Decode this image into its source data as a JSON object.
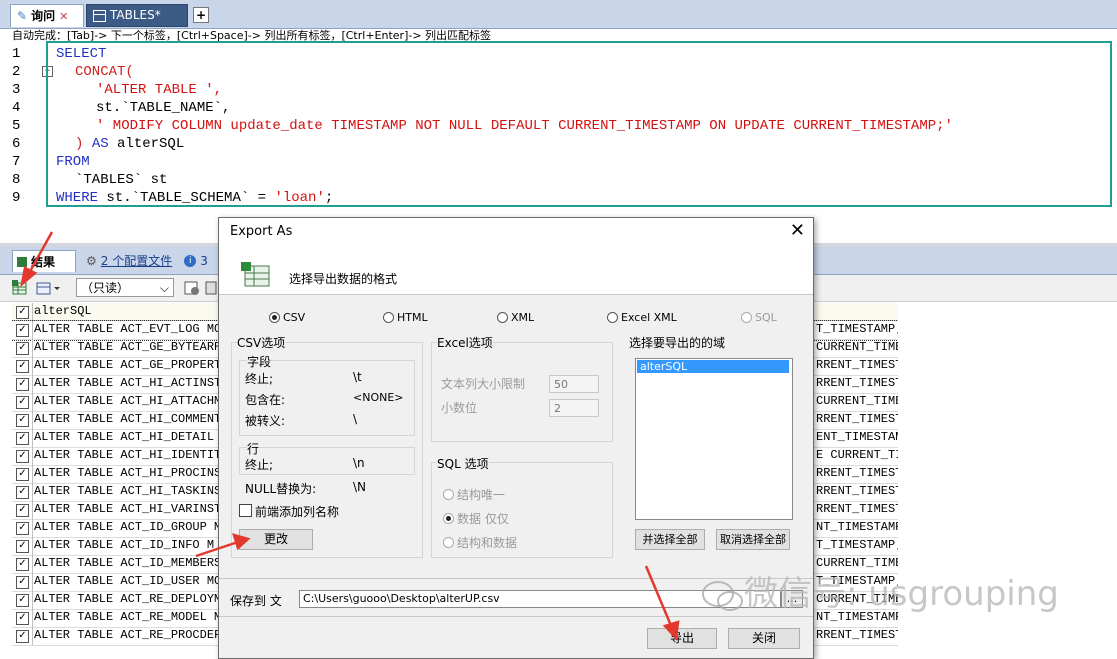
{
  "tabs": [
    {
      "label": "询问",
      "active": true
    },
    {
      "label": "TABLES*",
      "active": false
    }
  ],
  "hint": "自动完成：[Tab]-> 下一个标签，[Ctrl+Space]-> 列出所有标签，[Ctrl+Enter]-> 列出匹配标签",
  "editor": {
    "line_numbers": [
      "1",
      "2",
      "3",
      "4",
      "5",
      "6",
      "7",
      "8",
      "9"
    ],
    "lines": [
      {
        "k1": "SELECT"
      },
      {
        "k1": "CONCAT",
        "t1": "("
      },
      {
        "s1": "'ALTER TABLE ',"
      },
      {
        "t1": "st.`TABLE_NAME`,"
      },
      {
        "s1": "' MODIFY COLUMN update_date TIMESTAMP NOT NULL DEFAULT CURRENT_TIMESTAMP ON UPDATE CURRENT_TIMESTAMP;'"
      },
      {
        "t0": ") ",
        "k1": "AS",
        "t1": " alterSQL"
      },
      {
        "k1": "FROM"
      },
      {
        "t1": "`TABLES` st"
      },
      {
        "k1": "WHERE",
        "t1": " st.`TABLE_SCHEMA` = ",
        "s1": "'loan'",
        "t2": ";"
      }
    ]
  },
  "results": {
    "tab_result": "结果",
    "tab_config": "2 个配置文件",
    "tab_extra": "3",
    "readonly_select": "（只读）",
    "column_header": "alterSQL",
    "rows": [
      {
        "left": "ALTER TABLE ACT_EVT_LOG MO",
        "right": "T_TIMESTAMP;"
      },
      {
        "left": "ALTER TABLE ACT_GE_BYTEARR",
        "right": "CURRENT_TIMES"
      },
      {
        "left": "ALTER TABLE ACT_GE_PROPERT",
        "right": "RRENT_TIMESTA"
      },
      {
        "left": "ALTER TABLE ACT_HI_ACTINST",
        "right": "RRENT_TIMESTA"
      },
      {
        "left": "ALTER TABLE ACT_HI_ATTACHM",
        "right": "CURRENT_TIME"
      },
      {
        "left": "ALTER TABLE ACT_HI_COMMENT",
        "right": "RRENT_TIMESTA"
      },
      {
        "left": "ALTER TABLE ACT_HI_DETAIL ",
        "right": "ENT_TIMESTAM"
      },
      {
        "left": "ALTER TABLE ACT_HI_IDENTIT",
        "right": "E CURRENT_TI"
      },
      {
        "left": "ALTER TABLE ACT_HI_PROCINS",
        "right": "RRENT_TIMEST"
      },
      {
        "left": "ALTER TABLE ACT_HI_TASKINS",
        "right": "RRENT_TIMEST"
      },
      {
        "left": "ALTER TABLE ACT_HI_VARINST",
        "right": "RRENT_TIMESTA"
      },
      {
        "left": "ALTER TABLE ACT_ID_GROUP M",
        "right": "NT_TIMESTAMP"
      },
      {
        "left": "ALTER TABLE ACT_ID_INFO M",
        "right": "T_TIMESTAMP;"
      },
      {
        "left": "ALTER TABLE ACT_ID_MEMBERS",
        "right": "CURRENT_TIME"
      },
      {
        "left": "ALTER TABLE ACT_ID_USER MO",
        "right": "T_TIMESTAMP;"
      },
      {
        "left": "ALTER TABLE ACT_RE_DEPLOYM",
        "right": "CURRENT_TIME"
      },
      {
        "left": "ALTER TABLE ACT_RE_MODEL M",
        "right": "NT_TIMESTAMP"
      },
      {
        "left": "ALTER TABLE ACT_RE_PROCDEF",
        "right": "RRENT_TIMESTA"
      }
    ]
  },
  "dialog": {
    "title": "Export As",
    "heading": "选择导出数据的格式",
    "formats": [
      {
        "label": "CSV",
        "selected": true,
        "disabled": false
      },
      {
        "label": "HTML",
        "selected": false,
        "disabled": false
      },
      {
        "label": "XML",
        "selected": false,
        "disabled": false
      },
      {
        "label": "Excel  XML",
        "selected": false,
        "disabled": false
      },
      {
        "label": "SQL",
        "selected": false,
        "disabled": true
      }
    ],
    "csv": {
      "group_title": "CSV选项",
      "fields_title": "字段",
      "terminated_label": "终止;",
      "terminated_value": "\\t",
      "enclosed_label": "包含在:",
      "enclosed_value": "<NONE>",
      "escaped_label": "被转义:",
      "escaped_value": "\\",
      "lines_title": "行",
      "line_term_label": "终止;",
      "line_term_value": "\\n",
      "null_label": "NULL替换为:",
      "null_value": "\\N",
      "add_header_label": "前端添加列名称",
      "change_button": "更改"
    },
    "excel": {
      "group_title": "Excel选项",
      "text_limit_label": "文本列大小限制",
      "text_limit_value": "50",
      "decimals_label": "小数位",
      "decimals_value": "2"
    },
    "sql": {
      "group_title": "SQL 选项",
      "options": [
        {
          "label": "结构唯一",
          "selected": false
        },
        {
          "label": "数据 仅仅",
          "selected": true
        },
        {
          "label": "结构和数据",
          "selected": false
        }
      ]
    },
    "fields": {
      "title": "选择要导出的的域",
      "items": [
        "alterSQL"
      ],
      "select_all": "并选择全部",
      "deselect_all": "取消选择全部"
    },
    "save_label": "保存到 文",
    "save_path": "C:\\Users\\guooo\\Desktop\\alterUP.csv",
    "browse": "...",
    "export_button": "导出",
    "close_button": "关闭"
  },
  "watermark": "微信号: usgrouping",
  "colors": {
    "arrow": "#e2392f",
    "editor_border": "#1f9e91",
    "keyword": "#2330c8",
    "string": "#d41010"
  }
}
